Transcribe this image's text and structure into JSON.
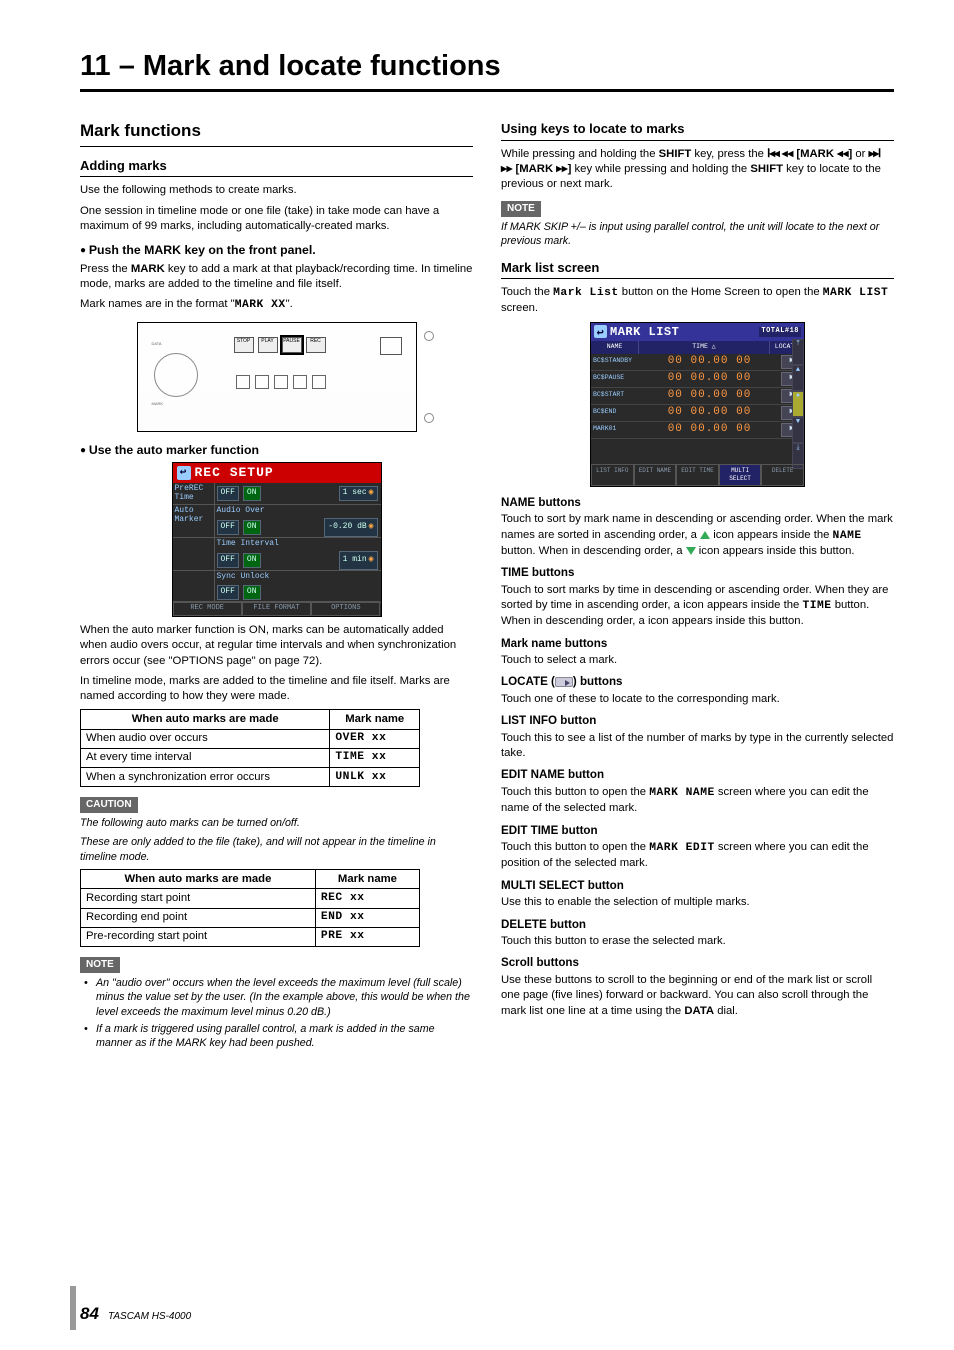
{
  "chapter_title": "11 – Mark and locate functions",
  "left": {
    "h2": "Mark functions",
    "adding": {
      "h3": "Adding marks",
      "p1": "Use the following methods to create marks.",
      "p2": "One session in timeline mode or one file (take) in take mode can have a maximum of 99 marks, including automatically-created marks.",
      "push_head": "Push the MARK key on the front panel.",
      "push_p1a": "Press the ",
      "push_p1b": "MARK",
      "push_p1c": " key to add a mark at that playback/recording time. In timeline mode, marks are added to the timeline and file itself.",
      "push_p2a": "Mark names are in the format \"",
      "push_p2b": "MARK XX",
      "push_p2c": "\"."
    },
    "fig_rec_setup": {
      "title": "REC SETUP",
      "rows": [
        {
          "label": "PreREC\nTime",
          "off": "OFF",
          "on": "ON",
          "val": "1 sec"
        },
        {
          "label": "Auto\nMarker",
          "sub": "Audio Over",
          "off": "OFF",
          "on": "ON",
          "val": "-0.20 dB"
        },
        {
          "label": "",
          "sub": "Time Interval",
          "off": "OFF",
          "on": "ON",
          "val": "1 min"
        },
        {
          "label": "",
          "sub": "Sync Unlock",
          "off": "OFF",
          "on": "ON",
          "val": ""
        }
      ],
      "bottom": [
        "REC MODE",
        "FILE FORMAT",
        "OPTIONS"
      ]
    },
    "auto": {
      "head": "Use the auto marker function",
      "p1": "When the auto marker function is ON, marks can be automatically added when audio overs occur, at regular time intervals and when synchronization errors occur (see \"OPTIONS page\" on page 72).",
      "p2": "In timeline mode, marks are added to the timeline and file itself. Marks are named according to how they were made."
    },
    "table1_head": [
      "When auto marks are made",
      "Mark name"
    ],
    "table1": [
      [
        "When audio over occurs",
        "OVER xx"
      ],
      [
        "At every time interval",
        "TIME xx"
      ],
      [
        "When a synchronization error occurs",
        "UNLK xx"
      ]
    ],
    "caution_label": "CAUTION",
    "caution_p1": "The following auto marks can be turned on/off.",
    "caution_p2": "These are only added to the file (take), and will not appear in the timeline in timeline mode.",
    "table2_head": [
      "When auto marks are made",
      "Mark name"
    ],
    "table2": [
      [
        "Recording start point",
        "REC xx"
      ],
      [
        "Recording end point",
        "END xx"
      ],
      [
        "Pre-recording start point",
        "PRE xx"
      ]
    ],
    "note_label": "NOTE",
    "notes": [
      "An \"audio over\" occurs when the level exceeds the maximum level (full scale) minus the value set by the user. (In the example above, this would be when the level exceeds the maximum level minus 0.20 dB.)",
      "If a mark is triggered using parallel control, a mark is added in the same manner as if the MARK key had been pushed."
    ]
  },
  "right": {
    "locate": {
      "h3": "Using keys to locate to marks",
      "p1a": "While pressing and holding the ",
      "p1b": "SHIFT",
      "p1c": " key, press the ",
      "p1d": "◂◂ [MARK ◂◂]",
      "p1e": " or ",
      "p1f": "▸▸ [MARK ▸▸]",
      "p1g": " key while pressing and holding the ",
      "p1h": "SHIFT",
      "p1i": " key to locate to the previous or next mark.",
      "note_label": "NOTE",
      "note": "If MARK SKIP +/– is input using parallel control, the unit will locate to the next or previous mark."
    },
    "screen": {
      "h3": "Mark list screen",
      "p1a": "Touch the ",
      "p1b": "Mark List",
      "p1c": " button on the Home Screen to open the ",
      "p1d": "MARK LIST",
      "p1e": " screen."
    },
    "fig_mark_list": {
      "title": "MARK LIST",
      "total": "TOTAL#18",
      "header": [
        "NAME",
        "TIME",
        "LOCATE"
      ],
      "rows": [
        {
          "name": "BC$STANDBY",
          "time": "00 00.00 00"
        },
        {
          "name": "BC$PAUSE",
          "time": "00 00.00 00"
        },
        {
          "name": "BC$START",
          "time": "00 00.00 00"
        },
        {
          "name": "BC$END",
          "time": "00 00.00 00"
        },
        {
          "name": "MARK01",
          "time": "00 00.00 00"
        }
      ],
      "bottom": [
        "LIST INFO",
        "EDIT NAME",
        "EDIT TIME",
        "MULTI SELECT",
        "DELETE"
      ]
    },
    "defs": [
      {
        "head": "NAME buttons",
        "body_parts": [
          "Touch to sort by mark name in descending or ascending order. When the mark names are sorted in ascending order, a ",
          " icon appears inside the ",
          "NAME",
          " button. When in descending order, a ",
          " icon appears inside this button."
        ],
        "icons": [
          "tri-up",
          "mono",
          "tri-dn"
        ]
      },
      {
        "head": "TIME buttons",
        "body_parts": [
          "Touch to sort marks by time in descending or ascending order. When they are sorted by time in ascending order, a ",
          " icon appears inside the ",
          "TIME",
          " button. When in descending order, a ",
          " icon appears inside this button."
        ],
        "icons": [
          "tri-up-blank",
          "mono",
          "tri-dn-blank"
        ]
      },
      {
        "head": "Mark name buttons",
        "body": "Touch to select a mark."
      },
      {
        "head": "LOCATE ( ) buttons",
        "has_loc_icon": true,
        "body": "Touch one of these to locate to the corresponding mark."
      },
      {
        "head": "LIST INFO button",
        "body": "Touch this to see a list of the number of marks by type in the currently selected take."
      },
      {
        "head": "EDIT NAME button",
        "body_parts": [
          "Touch this button to open the ",
          "MARK NAME",
          " screen where you can edit the name of the selected mark."
        ],
        "mono_idx": 1
      },
      {
        "head": "EDIT TIME button",
        "body_parts": [
          "Touch this button to open the ",
          "MARK EDIT",
          " screen where you can edit the position of the selected mark."
        ],
        "mono_idx": 1
      },
      {
        "head": "MULTI SELECT button",
        "body": "Use this to enable the selection of multiple marks."
      },
      {
        "head": "DELETE button",
        "body": "Touch this button to erase the selected mark."
      },
      {
        "head": "Scroll buttons",
        "body_parts": [
          "Use these buttons to scroll to the beginning or end of the mark list or scroll one page (five lines) forward or backward. You can also scroll through the mark list one line at a time using the ",
          "DATA",
          " dial."
        ],
        "bold_idx": 1
      }
    ]
  },
  "footer": {
    "page": "84",
    "brand": "TASCAM HS-4000"
  }
}
